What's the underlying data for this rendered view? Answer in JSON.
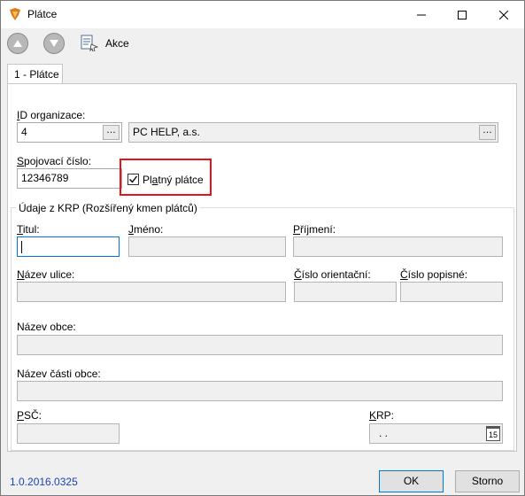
{
  "window": {
    "title": "Plátce",
    "icon": "app-logo-icon",
    "controls": [
      "minimize-icon",
      "maximize-icon",
      "close-icon"
    ]
  },
  "toolbar": {
    "up_icon": "arrow-up-icon",
    "down_icon": "arrow-down-icon",
    "actions_label": "Akce"
  },
  "tabs": [
    {
      "label": "1 - Plátce"
    }
  ],
  "form": {
    "id_org_label": "ID organizace:",
    "id_org_value": "4",
    "org_name_value": "PC HELP, a.s.",
    "spoj_label": "Spojovací číslo:",
    "spoj_value": "12346789",
    "platny_label": "Platný plátce",
    "platny_checked": true
  },
  "krp": {
    "group_title": "Údaje z KRP (Rozšířený kmen plátců)",
    "titul_label": "Titul:",
    "jmeno_label": "Jméno:",
    "prijmeni_label": "Příjmení:",
    "ulice_label": "Název ulice:",
    "cislo_orient_label": "Číslo orientační:",
    "cislo_pop_label": "Číslo popisné:",
    "obec_label": "Název obce:",
    "cast_obce_label": "Název části obce:",
    "psc_label": "PSČ:",
    "krp_label": "KRP:",
    "krp_value": ". .",
    "calendar_day": "15"
  },
  "footer": {
    "version": "1.0.2016.0325",
    "ok_label": "OK",
    "cancel_label": "Storno"
  },
  "colors": {
    "highlight": "#e3141b",
    "version_text": "#1a44b0",
    "focus_border": "#0078d7"
  }
}
